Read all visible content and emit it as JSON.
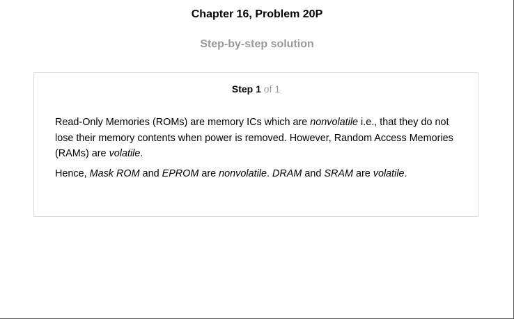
{
  "header": {
    "title": "Chapter 16, Problem 20P",
    "subtitle": "Step-by-step solution"
  },
  "step": {
    "word": "Step",
    "number": "1",
    "of_text": "of 1"
  },
  "solution": {
    "p1_a": "Read-Only Memories (ROMs) are memory ICs which are ",
    "p1_b": "nonvolatile",
    "p1_c": " i.e., that they do not lose their memory contents when power is removed. However, Random Access Memories (RAMs) are ",
    "p1_d": "volatile",
    "p1_e": ".",
    "p2_a": "Hence, ",
    "p2_b": "Mask ROM",
    "p2_c": " and ",
    "p2_d": "EPROM",
    "p2_e": " are ",
    "p2_f": "nonvolatile",
    "p2_g": ". ",
    "p2_h": "DRAM",
    "p2_i": " and ",
    "p2_j": "SRAM",
    "p2_k": " are ",
    "p2_l": "volatile",
    "p2_m": "."
  }
}
